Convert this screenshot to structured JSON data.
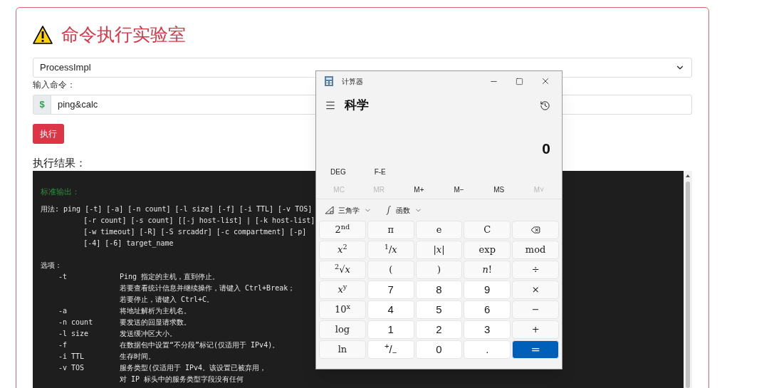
{
  "page": {
    "title": "命令执行实验室",
    "select": {
      "value": "ProcessImpl"
    },
    "command_label": "输入命令：",
    "command": {
      "prefix": "$",
      "value": "ping&calc"
    },
    "run_button": "执行",
    "result_label": "执行结果：",
    "terminal": {
      "heading": "标准输出：",
      "usage": [
        "用法: ping [-t] [-a] [-n count] [-l size] [-f] [-i TTL] [-v TOS]",
        "          [-r count] [-s count] [[-j host-list] | [-k host-list]",
        "          [-w timeout] [-R] [-S srcaddr] [-c compartment] [-p]",
        "          [-4] [-6] target_name"
      ],
      "options_label": "选项：",
      "options": [
        {
          "flag": "-t",
          "text": "Ping 指定的主机，直到停止。"
        },
        {
          "text": "若要查看统计信息并继续操作，请键入 Ctrl+Break；"
        },
        {
          "text": "若要停止，请键入 Ctrl+C。"
        },
        {
          "flag": "-a",
          "text": "将地址解析为主机名。"
        },
        {
          "flag": "-n count",
          "text": "要发送的回显请求数。"
        },
        {
          "flag": "-l size",
          "text": "发送缓冲区大小。"
        },
        {
          "flag": "-f",
          "text": "在数据包中设置“不分段”标记(仅适用于 IPv4)。"
        },
        {
          "flag": "-i TTL",
          "text": "生存时间。"
        },
        {
          "flag": "-v TOS",
          "text": "服务类型(仅适用于 IPv4。该设置已被弃用，"
        },
        {
          "text": "对 IP 标头中的服务类型字段没有任何"
        }
      ]
    }
  },
  "calculator": {
    "title": "计算器",
    "mode": "科学",
    "display": "0",
    "toggles": [
      "DEG",
      "F-E"
    ],
    "memory": [
      {
        "label": "MC",
        "disabled": true
      },
      {
        "label": "MR",
        "disabled": true
      },
      {
        "label": "M+",
        "disabled": false
      },
      {
        "label": "M−",
        "disabled": false
      },
      {
        "label": "MS",
        "disabled": false
      },
      {
        "label": "M˅",
        "disabled": true
      }
    ],
    "menus": [
      {
        "kind": "trig",
        "label": "三角学"
      },
      {
        "kind": "func",
        "label": "函数"
      }
    ],
    "keys": [
      {
        "kind": "fn",
        "label": "2$^{nd}$"
      },
      {
        "kind": "fn",
        "label": "π"
      },
      {
        "kind": "fn",
        "label": "e"
      },
      {
        "kind": "fn",
        "label": "C"
      },
      {
        "kind": "backspace"
      },
      {
        "kind": "fn",
        "label": "*x*$^{2}$"
      },
      {
        "kind": "fn",
        "label": "$^{1}$/*x*"
      },
      {
        "kind": "fn",
        "label": "|*x*|"
      },
      {
        "kind": "fn",
        "label": "exp"
      },
      {
        "kind": "fn",
        "label": "mod"
      },
      {
        "kind": "fn",
        "label": "$^{2}$√*x*"
      },
      {
        "kind": "fn",
        "label": "("
      },
      {
        "kind": "fn",
        "label": ")"
      },
      {
        "kind": "fn",
        "label": "*n*!"
      },
      {
        "kind": "fn",
        "label": "÷"
      },
      {
        "kind": "fn",
        "label": "*x*$^{y}$"
      },
      {
        "kind": "num",
        "label": "7"
      },
      {
        "kind": "num",
        "label": "8"
      },
      {
        "kind": "num",
        "label": "9"
      },
      {
        "kind": "fn",
        "label": "×"
      },
      {
        "kind": "fn",
        "label": "10$^{x}$"
      },
      {
        "kind": "num",
        "label": "4"
      },
      {
        "kind": "num",
        "label": "5"
      },
      {
        "kind": "num",
        "label": "6"
      },
      {
        "kind": "fn",
        "label": "−"
      },
      {
        "kind": "fn",
        "label": "log"
      },
      {
        "kind": "num",
        "label": "1"
      },
      {
        "kind": "num",
        "label": "2"
      },
      {
        "kind": "num",
        "label": "3"
      },
      {
        "kind": "fn",
        "label": "+"
      },
      {
        "kind": "fn",
        "label": "ln"
      },
      {
        "kind": "num",
        "label": "$^{+}$/$_{−}$"
      },
      {
        "kind": "num",
        "label": "0"
      },
      {
        "kind": "num",
        "label": "."
      },
      {
        "kind": "equals",
        "label": "="
      }
    ]
  }
}
